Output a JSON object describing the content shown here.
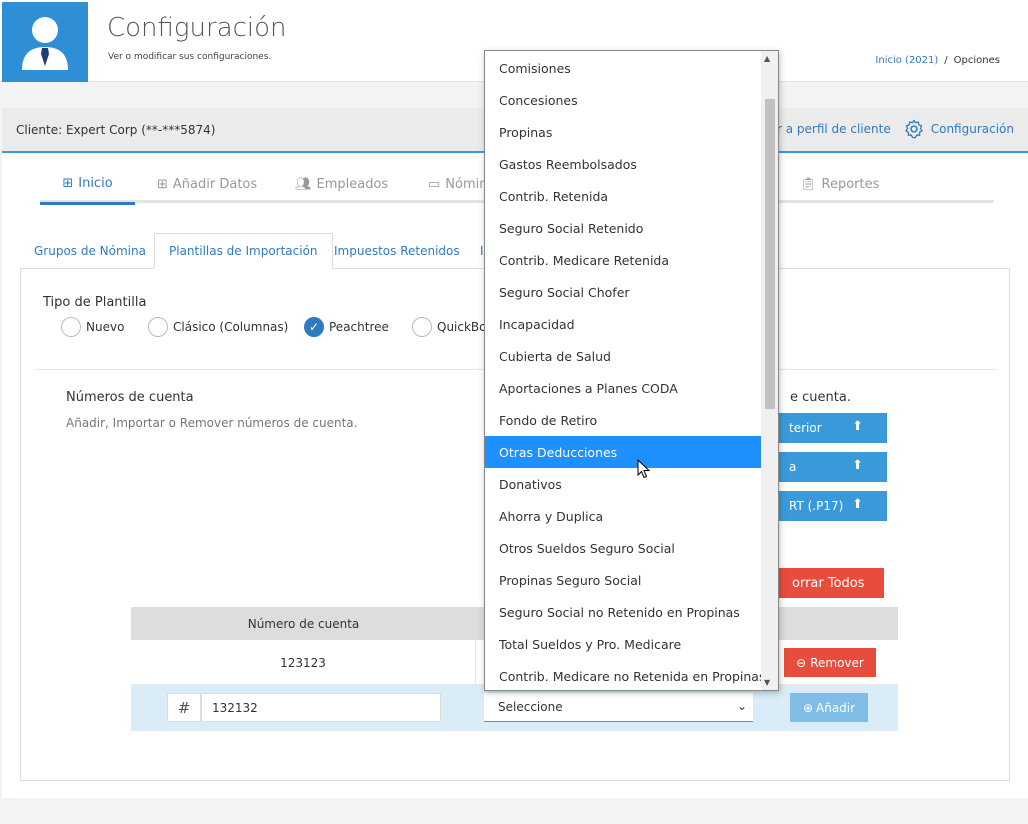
{
  "header": {
    "title": "Configuración",
    "subtitle": "Ver o modificar sus configuraciones.",
    "breadcrumb_link": "Inicio (2021)",
    "breadcrumb_sep": "/",
    "breadcrumb_current": "Opciones"
  },
  "client": {
    "label": "Cliente: Expert Corp (**-***5874)",
    "profile_link": "Ir a perfil de cliente",
    "config_link": "Configuración"
  },
  "main_tabs": [
    {
      "label": "Inicio",
      "icon": "table-icon"
    },
    {
      "label": "Añadir Datos",
      "icon": "plus-square-icon"
    },
    {
      "label": "Empleados",
      "icon": "users-icon"
    },
    {
      "label": "Nómin",
      "icon": "id-card-icon"
    },
    {
      "label": "Reportes",
      "icon": "clipboard-icon"
    }
  ],
  "sub_tabs": [
    "Grupos de Nómina",
    "Plantillas de Importación",
    "Impuestos Retenidos",
    "I"
  ],
  "template_type": {
    "title": "Tipo de Plantilla",
    "options": [
      "Nuevo",
      "Clásico (Columnas)",
      "Peachtree",
      "QuickBoo"
    ],
    "selected": "Peachtree"
  },
  "accounts": {
    "title": "Números de cuenta",
    "description": "Añadir, Importar o Remover números de cuenta.",
    "right_heading": "e cuenta.",
    "upload_buttons": [
      "terior",
      "a",
      "RT (.P17)"
    ],
    "delete_all": "orrar Todos"
  },
  "table": {
    "header_account": "Número de cuenta",
    "rows": [
      {
        "account": "123123"
      }
    ],
    "remove_label": "Remover",
    "input_prefix": "#",
    "input_value": "132132",
    "select_value": "Seleccione",
    "add_label": "Añadir"
  },
  "dropdown": {
    "items": [
      "Comisiones",
      "Concesiones",
      "Propinas",
      "Gastos Reembolsados",
      "Contrib. Retenida",
      "Seguro Social Retenido",
      "Contrib. Medicare Retenida",
      "Seguro Social Chofer",
      "Incapacidad",
      "Cubierta de Salud",
      "Aportaciones a Planes CODA",
      "Fondo de Retiro",
      "Otras Deducciones",
      "Donativos",
      "Ahorra y Duplica",
      "Otros Sueldos Seguro Social",
      "Propinas Seguro Social",
      "Seguro Social no Retenido en Propinas",
      "Total Sueldos y Pro. Medicare",
      "Contrib. Medicare no Retenida en Propinas"
    ],
    "highlighted": "Otras Deducciones"
  },
  "colors": {
    "brand_blue": "#2f7bbf",
    "header_avatar_bg": "#2f8fd6",
    "highlight": "#1e90ff",
    "danger": "#e84c3d"
  }
}
